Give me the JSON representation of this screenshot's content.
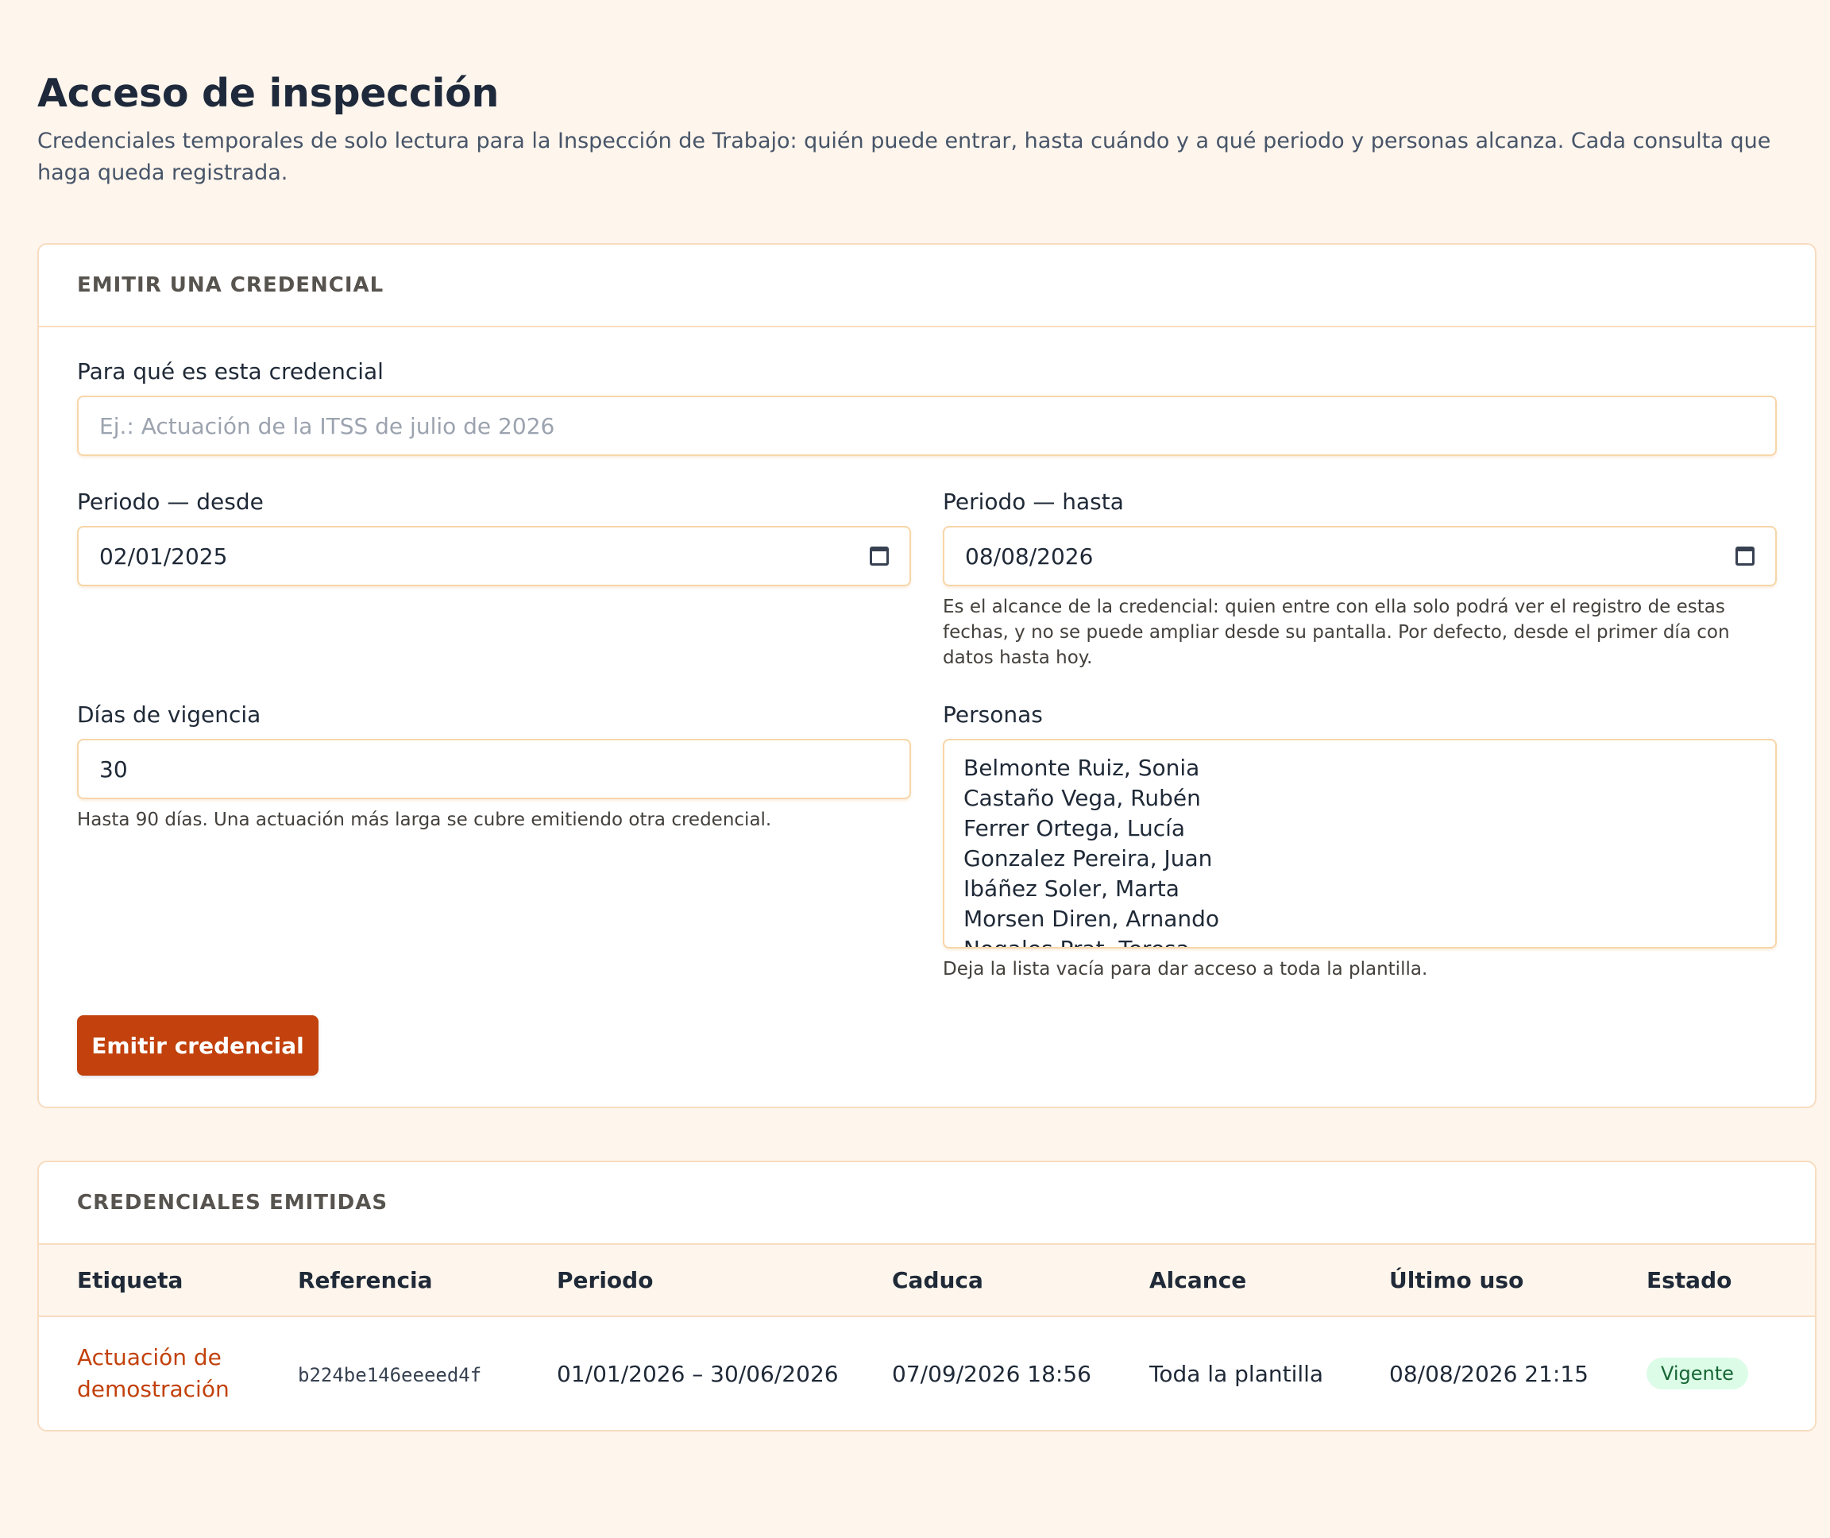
{
  "header": {
    "title": "Acceso de inspección",
    "description": "Credenciales temporales de solo lectura para la Inspección de Trabajo: quién puede entrar, hasta cuándo y a qué periodo y personas alcanza. Cada consulta que haga queda registrada."
  },
  "issue_form": {
    "section_title": "EMITIR UNA CREDENCIAL",
    "purpose": {
      "label": "Para qué es esta credencial",
      "placeholder": "Ej.: Actuación de la ITSS de julio de 2026",
      "value": ""
    },
    "period_from": {
      "label": "Periodo — desde",
      "value": "02/01/2025",
      "icon": "calendar-icon"
    },
    "period_to": {
      "label": "Periodo — hasta",
      "value": "08/08/2026",
      "icon": "calendar-icon",
      "hint": "Es el alcance de la credencial: quien entre con ella solo podrá ver el registro de estas fechas, y no se puede ampliar desde su pantalla. Por defecto, desde el primer día con datos hasta hoy."
    },
    "validity_days": {
      "label": "Días de vigencia",
      "value": "30",
      "hint": "Hasta 90 días. Una actuación más larga se cubre emitiendo otra credencial."
    },
    "people": {
      "label": "Personas",
      "options": [
        "Belmonte Ruiz, Sonia",
        "Castaño Vega, Rubén",
        "Ferrer Ortega, Lucía",
        "Gonzalez Pereira, Juan",
        "Ibáñez Soler, Marta",
        "Morsen Diren, Arnando",
        "Nogales Prat, Teresa"
      ],
      "hint": "Deja la lista vacía para dar acceso a toda la plantilla."
    },
    "submit_label": "Emitir credencial",
    "accent_color": "#c2410c"
  },
  "issued": {
    "section_title": "CREDENCIALES EMITIDAS",
    "columns": {
      "label": "Etiqueta",
      "reference": "Referencia",
      "period": "Periodo",
      "expires": "Caduca",
      "scope": "Alcance",
      "last_use": "Último uso",
      "status": "Estado"
    },
    "rows": [
      {
        "label": "Actuación de demostración",
        "reference": "b224be146eeeed4f",
        "period": "01/01/2026 – 30/06/2026",
        "expires": "07/09/2026 18:56",
        "scope": "Toda la plantilla",
        "last_use": "08/08/2026 21:15",
        "status": "Vigente",
        "status_color": "#166534"
      }
    ]
  }
}
